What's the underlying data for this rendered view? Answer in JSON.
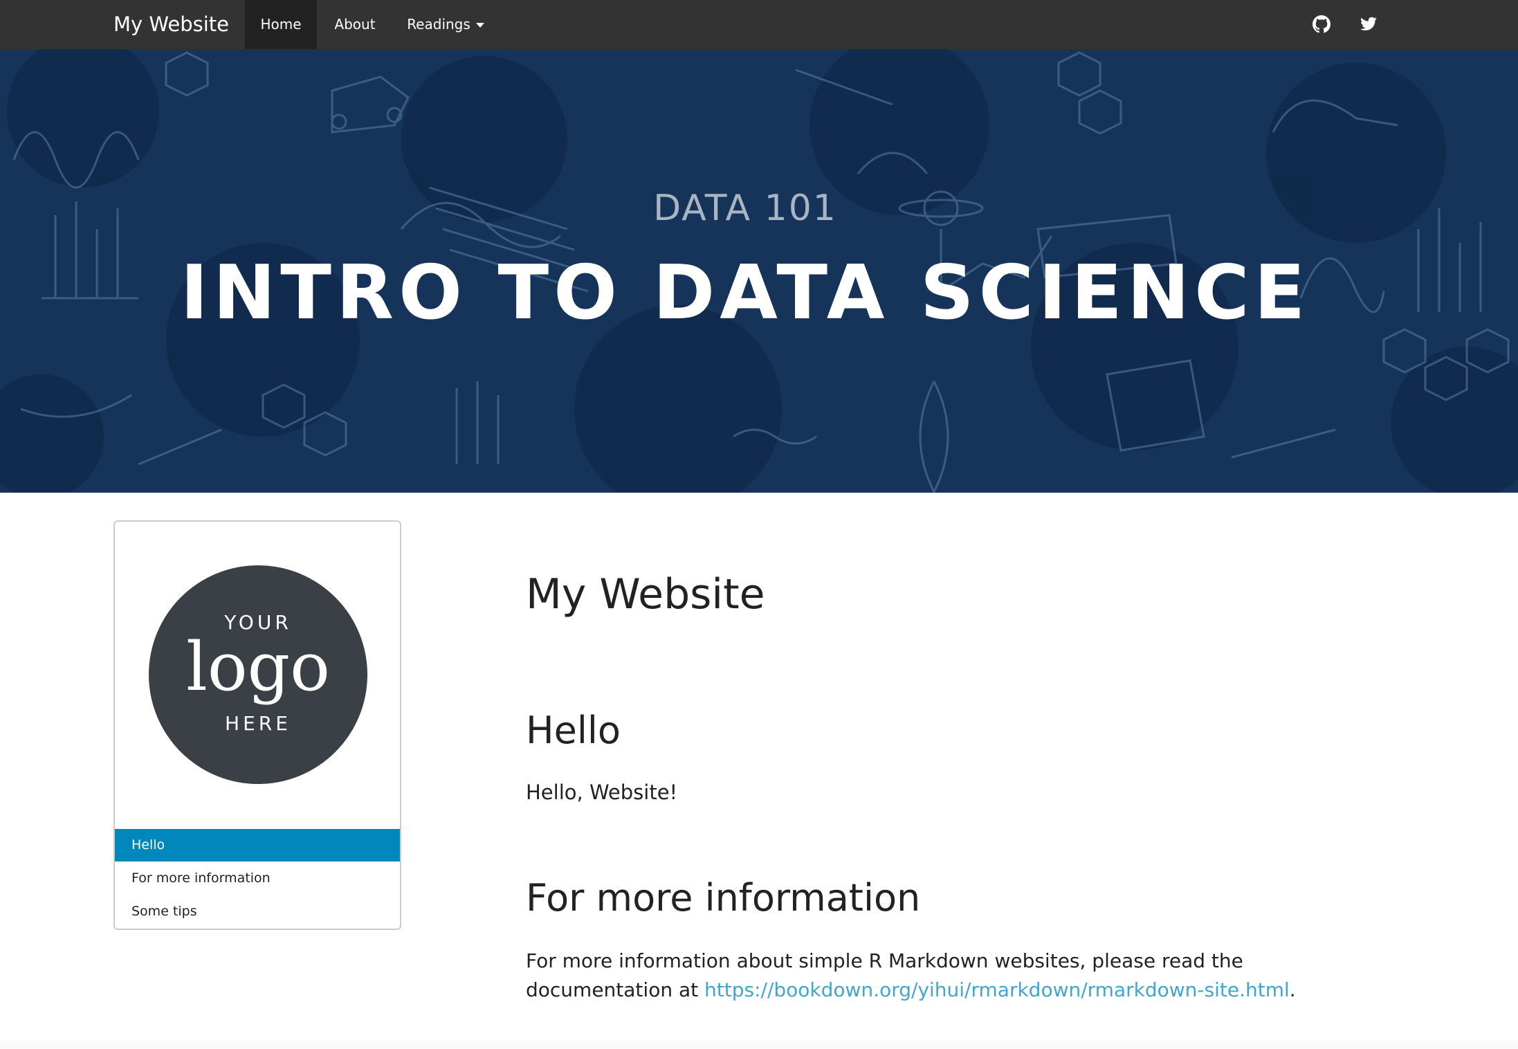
{
  "navbar": {
    "brand": "My Website",
    "items": [
      {
        "label": "Home"
      },
      {
        "label": "About"
      },
      {
        "label": "Readings"
      }
    ],
    "icons": [
      "github-icon",
      "twitter-icon"
    ]
  },
  "hero": {
    "subtitle": "DATA 101",
    "title": "INTRO TO DATA SCIENCE",
    "background_color": "#163459"
  },
  "sidebar": {
    "logo": {
      "top": "YOUR",
      "main": "logo",
      "bottom": "HERE"
    },
    "toc": [
      {
        "label": "Hello",
        "active": true
      },
      {
        "label": "For more information",
        "active": false
      },
      {
        "label": "Some tips",
        "active": false
      }
    ],
    "active_color": "#0088bc"
  },
  "main": {
    "title": "My Website",
    "sections": [
      {
        "heading": "Hello",
        "text": "Hello, Website!"
      },
      {
        "heading": "For more information",
        "text": "For more information about simple R Markdown websites, please read the documentation at",
        "link": "https://bookdown.org/yihui/rmarkdown/rmarkdown-site.html",
        "trailing": "."
      }
    ],
    "link_color": "#3fa7cf"
  }
}
